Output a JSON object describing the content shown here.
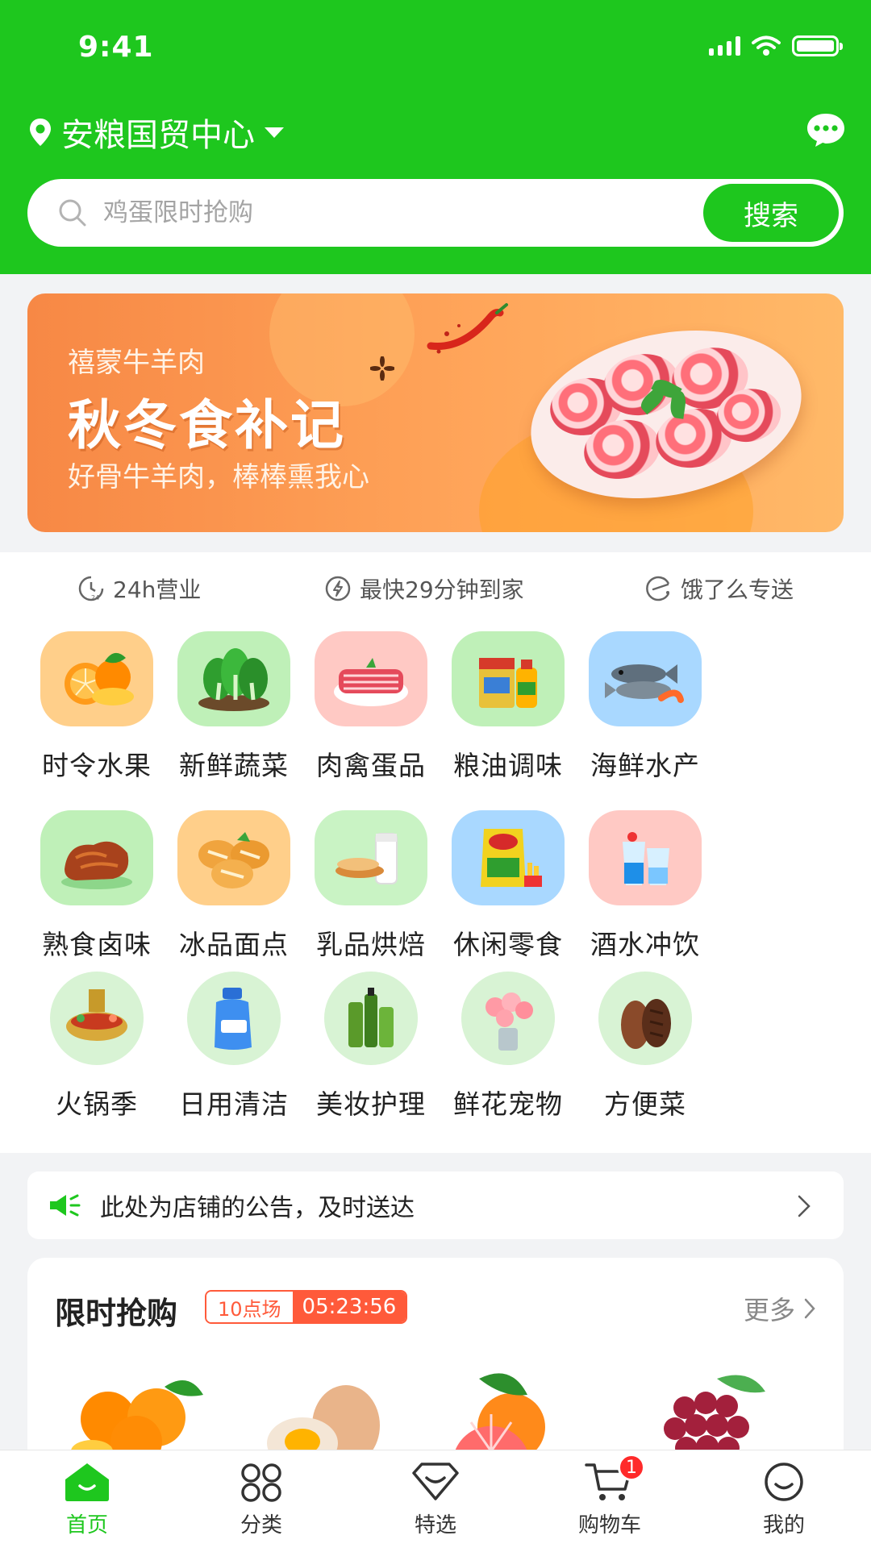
{
  "status_bar": {
    "time": "9:41"
  },
  "header": {
    "location": "安粮国贸中心",
    "search_placeholder": "鸡蛋限时抢购",
    "search_button": "搜索"
  },
  "banner": {
    "subtitle": "禧蒙牛羊肉",
    "title": "秋冬食补记",
    "description": "好骨牛羊肉，棒棒熏我心"
  },
  "features": [
    {
      "icon": "clock-24h-icon",
      "label": "24h营业"
    },
    {
      "icon": "lightning-icon",
      "label": "最快29分钟到家"
    },
    {
      "icon": "eleme-icon",
      "label": "饿了么专送"
    }
  ],
  "categories": [
    {
      "label": "时令水果",
      "icon": "fruit-icon",
      "bg": "#ffcf8a"
    },
    {
      "label": "新鲜蔬菜",
      "icon": "vegetable-icon",
      "bg": "#bff0b8"
    },
    {
      "label": "肉禽蛋品",
      "icon": "meat-icon",
      "bg": "#ffc9c4"
    },
    {
      "label": "粮油调味",
      "icon": "grain-oil-icon",
      "bg": "#bff0b8"
    },
    {
      "label": "海鲜水产",
      "icon": "seafood-icon",
      "bg": "#a9d8ff"
    },
    {
      "label": "熟食卤味",
      "icon": "cooked-food-icon",
      "bg": "#bff0b8"
    },
    {
      "label": "冰品面点",
      "icon": "bakery-icon",
      "bg": "#ffcf8a"
    },
    {
      "label": "乳品烘焙",
      "icon": "dairy-icon",
      "bg": "#c9f3c4"
    },
    {
      "label": "休闲零食",
      "icon": "snack-icon",
      "bg": "#a9d8ff"
    },
    {
      "label": "酒水冲饮",
      "icon": "drink-icon",
      "bg": "#ffc9c4"
    },
    {
      "label": "火锅季",
      "icon": "hotpot-icon",
      "bg": "#d8f3d4"
    },
    {
      "label": "日用清洁",
      "icon": "cleaning-icon",
      "bg": "#d8f3d4"
    },
    {
      "label": "美妆护理",
      "icon": "cosmetics-icon",
      "bg": "#d8f3d4"
    },
    {
      "label": "鲜花宠物",
      "icon": "flower-icon",
      "bg": "#d8f3d4"
    },
    {
      "label": "方便菜",
      "icon": "convenience-food-icon",
      "bg": "#d8f3d4"
    }
  ],
  "notice": {
    "text": "此处为店铺的公告，及时送达"
  },
  "flash_sale": {
    "title": "限时抢购",
    "session": "10点场",
    "countdown": "05:23:56",
    "more": "更多",
    "products": [
      {
        "icon": "orange-icon"
      },
      {
        "icon": "egg-icon"
      },
      {
        "icon": "grapefruit-icon"
      },
      {
        "icon": "grape-icon"
      }
    ]
  },
  "tabbar": [
    {
      "label": "首页",
      "icon": "home-icon",
      "active": true
    },
    {
      "label": "分类",
      "icon": "category-icon"
    },
    {
      "label": "特选",
      "icon": "diamond-icon"
    },
    {
      "label": "购物车",
      "icon": "cart-icon",
      "badge": "1"
    },
    {
      "label": "我的",
      "icon": "profile-icon"
    }
  ],
  "colors": {
    "brand": "#1ec71e",
    "accent": "#ff5a3a",
    "banner": "#f78845"
  }
}
